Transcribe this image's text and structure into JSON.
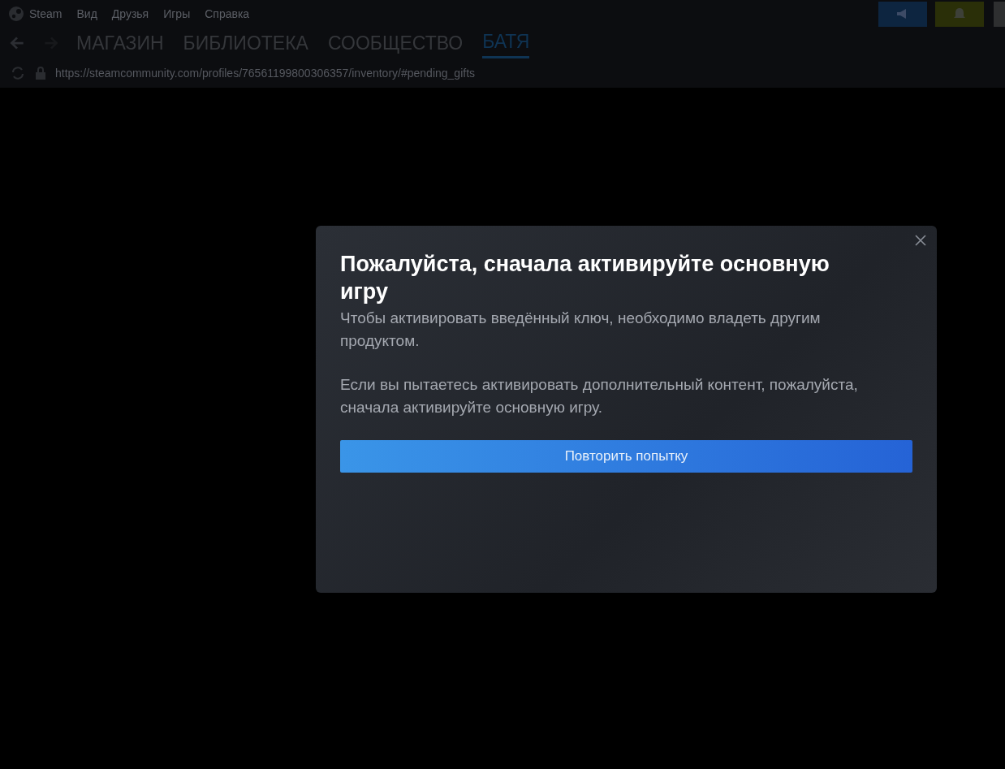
{
  "menu_bar": {
    "app_name": "Steam",
    "items": [
      "Вид",
      "Друзья",
      "Игры",
      "Справка"
    ]
  },
  "nav_tabs": [
    {
      "label": "МАГАЗИН",
      "selected": false
    },
    {
      "label": "БИБЛИОТЕКА",
      "selected": false
    },
    {
      "label": "СООБЩЕСТВО",
      "selected": false
    },
    {
      "label": "БАТЯ",
      "selected": true
    }
  ],
  "address_bar": {
    "url": "https://steamcommunity.com/profiles/76561199800306357/inventory/#pending_gifts"
  },
  "dialog": {
    "title": "Пожалуйста, сначала активируйте основную игру",
    "paragraphs": [
      "Чтобы активировать введённый ключ, необходимо владеть другим продуктом.",
      "Если вы пытаетесь активировать дополнительный контент, пожалуйста, сначала активируйте основную игру."
    ],
    "button": "Повторить попытку"
  }
}
